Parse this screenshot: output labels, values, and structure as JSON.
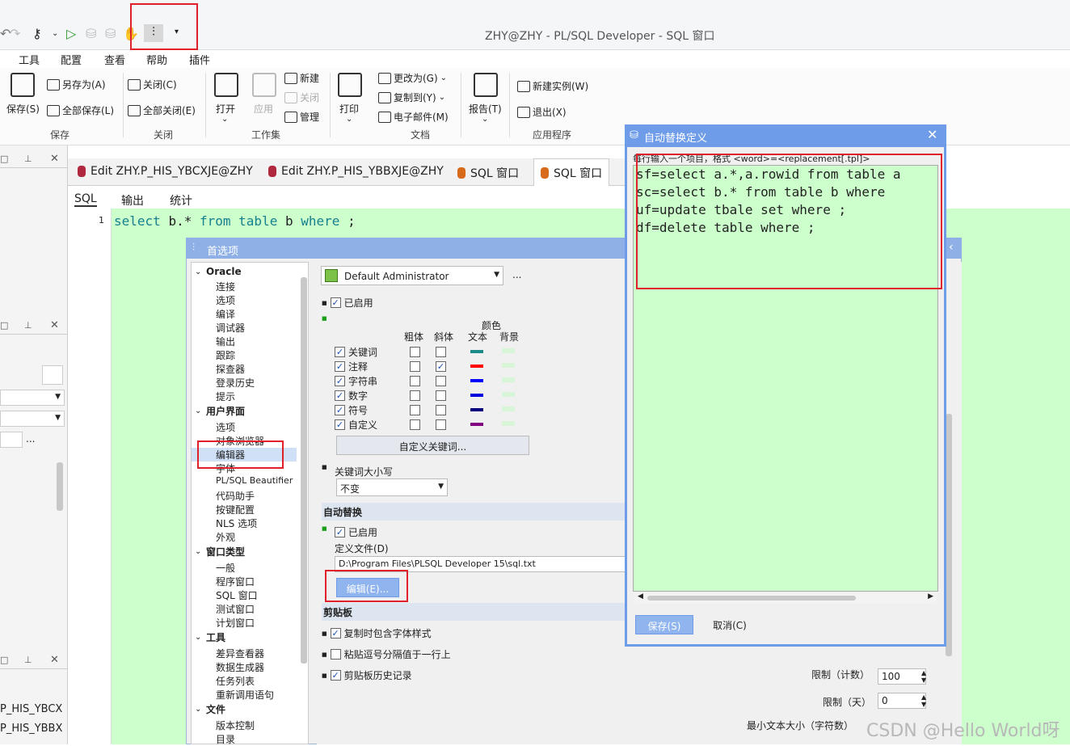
{
  "window": {
    "title": "ZHY@ZHY - PL/SQL Developer - SQL 窗口"
  },
  "menu": [
    "工具",
    "配置",
    "查看",
    "帮助",
    "插件"
  ],
  "ribbon": {
    "save": "保存(S)",
    "save_as": "另存为(A)",
    "save_all": "全部保存(L)",
    "group_save": "保存",
    "close": "关闭(C)",
    "close_all": "全部关闭(E)",
    "group_close": "关闭",
    "open": "打开",
    "apply": "应用",
    "ws_new": "新建",
    "ws_close": "关闭",
    "ws_manage": "管理",
    "group_workset": "工作集",
    "print": "打印",
    "change_to": "更改为(G)",
    "copy_to": "复制到(Y)",
    "email": "电子邮件(M)",
    "group_doc": "文档",
    "report": "报告(T)",
    "new_instance": "新建实例(W)",
    "exit": "退出(X)",
    "group_app": "应用程序"
  },
  "tabs": [
    "Edit ZHY.P_HIS_YBCXJE@ZHY",
    "Edit ZHY.P_HIS_YBBXJE@ZHY",
    "SQL 窗口",
    "SQL 窗口"
  ],
  "subtabs": [
    "SQL",
    "输出",
    "统计"
  ],
  "editor": {
    "line_no": "1",
    "kw1": "select",
    "t1": "b.*",
    "kw2": "from",
    "kw3": "table",
    "t2": "b",
    "kw4": "where",
    "t3": ";"
  },
  "left_items": [
    "P_HIS_YBCX",
    "P_HIS_YBBX"
  ],
  "prefs": {
    "title": "首选项",
    "tree": {
      "oracle": "Oracle",
      "oracle_items": [
        "连接",
        "选项",
        "编译",
        "调试器",
        "输出",
        "跟踪",
        "探查器",
        "登录历史",
        "提示"
      ],
      "ui": "用户界面",
      "ui_items": [
        "选项",
        "对象浏览器",
        "编辑器",
        "字体",
        "PL/SQL Beautifier",
        "代码助手",
        "按键配置",
        "NLS 选项",
        "外观"
      ],
      "wintype": "窗口类型",
      "wintype_items": [
        "一般",
        "程序窗口",
        "SQL 窗口",
        "测试窗口",
        "计划窗口"
      ],
      "tools": "工具",
      "tools_items": [
        "差异查看器",
        "数据生成器",
        "任务列表",
        "重新调用语句"
      ],
      "files": "文件",
      "files_items": [
        "版本控制",
        "目录"
      ]
    },
    "profile": "Default Administrator",
    "ellipsis": "...",
    "enabled": "已启用",
    "col_bold": "粗体",
    "col_italic": "斜体",
    "col_color": "颜色",
    "col_text": "文本",
    "col_bg": "背景",
    "rows": [
      {
        "label": "关键词",
        "color": "#1a8a8a"
      },
      {
        "label": "注释",
        "color": "#ff0000"
      },
      {
        "label": "字符串",
        "color": "#0000ff"
      },
      {
        "label": "数字",
        "color": "#0000dd"
      },
      {
        "label": "符号",
        "color": "#000080"
      },
      {
        "label": "自定义",
        "color": "#800080"
      }
    ],
    "custom_kw_btn": "自定义关键词...",
    "kw_case": "关键词大小写",
    "kw_case_val": "不变",
    "auto_replace": "自动替换",
    "ar_enabled": "已启用",
    "def_file": "定义文件(D)",
    "def_file_path": "D:\\Program Files\\PLSQL Developer 15\\sql.txt",
    "edit_btn": "编辑(E)...",
    "clipboard": "剪贴板",
    "copy_font": "复制时包含字体样式",
    "paste_comma": "粘贴逗号分隔值于一行上",
    "clip_history": "剪贴板历史记录",
    "limit_count": "限制（计数）",
    "limit_count_val": "100",
    "limit_days": "限制（天）",
    "limit_days_val": "0",
    "min_text": "最小文本大小（字符数）"
  },
  "dialog": {
    "title": "自动替换定义",
    "hint": "每行输入一个项目，格式 <word>=<replacement[.tpl]>",
    "lines": [
      "sf=select a.*,a.rowid from table a",
      "sc=select b.* from table b where",
      "uf=update tbale set where ;",
      "df=delete table where ;"
    ],
    "save": "保存(S)",
    "cancel": "取消(C)"
  },
  "watermark": "CSDN @Hello World呀"
}
